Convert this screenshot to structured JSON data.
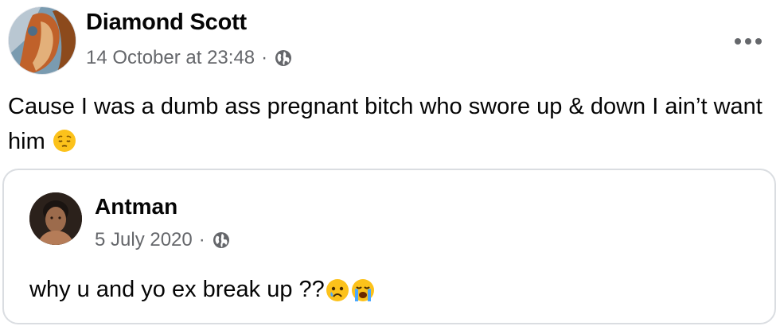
{
  "post": {
    "author": "Diamond Scott",
    "timestamp": "14 October at 23:48",
    "separator": "·",
    "privacy_icon": "globe-icon",
    "more_icon": "more-options-icon",
    "text": "Cause I was a dumb ass pregnant bitch who swore up & down I ain’t want him",
    "emoji": "😔"
  },
  "shared_post": {
    "author": "Antman",
    "timestamp": "5 July 2020",
    "separator": "·",
    "privacy_icon": "globe-icon",
    "text": "why u and yo ex break up ??",
    "emojis": [
      "😢",
      "😭"
    ]
  },
  "colors": {
    "text_primary": "#050505",
    "text_secondary": "#65676b",
    "card_border": "#dadde1"
  }
}
